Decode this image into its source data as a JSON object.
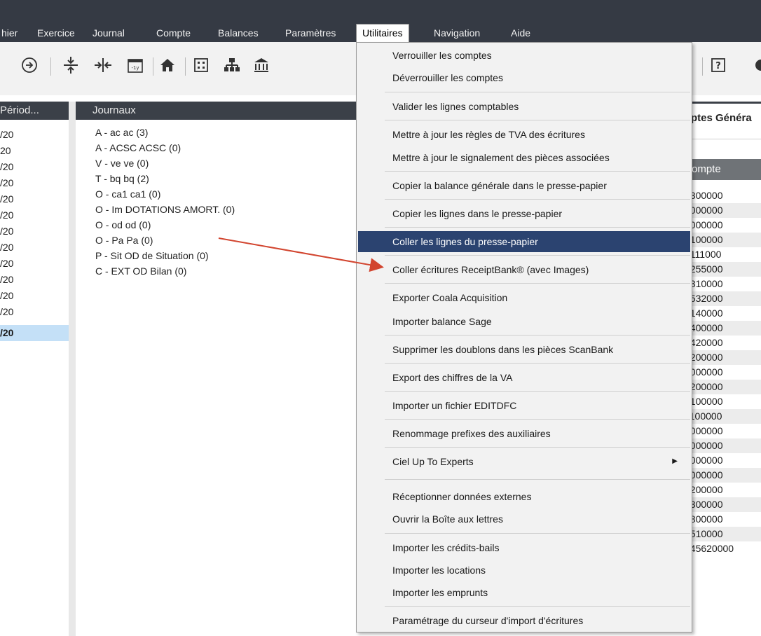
{
  "menu": {
    "items": [
      "hier",
      "Exercice",
      "Journal",
      "Compte",
      "Balances",
      "Paramètres",
      "Utilitaires",
      "Navigation",
      "Aide"
    ]
  },
  "toolbar": {
    "icons": [
      "arrow-right-circle-icon",
      "expand-vertical-icon",
      "collapse-horizontal-icon",
      "calendar-minus-1y-icon",
      "home-icon",
      "building-icon",
      "org-chart-icon",
      "bank-icon",
      "help-icon"
    ]
  },
  "periods": {
    "header": "Périod...",
    "rows": [
      "/20",
      "20",
      "/20",
      "/20",
      "/20",
      "/20",
      "/20",
      "/20",
      "/20",
      "/20",
      "/20",
      "/20",
      "/20"
    ]
  },
  "journals": {
    "header": "Journaux",
    "rows": [
      "A - ac ac (3)",
      "A - ACSC ACSC (0)",
      "V - ve ve (0)",
      "T - bq bq (2)",
      "O - ca1 ca1 (0)",
      "O - Im DOTATIONS AMORT. (0)",
      "O - od od (0)",
      "O - Pa Pa (0)",
      "P - Sit OD de Situation (0)",
      "C - EXT OD Bilan (0)"
    ]
  },
  "utilitaires_menu": {
    "items": [
      "Verrouiller les comptes",
      "Déverrouiller les comptes",
      "Valider les lignes comptables",
      "Mettre à jour les règles de TVA des écritures",
      "Mettre à jour le signalement des pièces associées",
      "Copier la balance générale dans le presse-papier",
      "Copier les lignes dans le presse-papier",
      "Coller les lignes du presse-papier",
      "Coller écritures ReceiptBank® (avec Images)",
      "Exporter Coala Acquisition",
      "Importer balance Sage",
      "Supprimer les doublons dans les pièces ScanBank",
      "Export des chiffres de la VA",
      "Importer un fichier EDITDFC",
      "Renommage prefixes des auxiliaires",
      "Ciel Up To Experts",
      "Réceptionner données externes",
      "Ouvrir la Boîte aux lettres",
      "Importer les crédits-bails",
      "Importer les locations",
      "Importer les emprunts",
      "Paramétrage du curseur d'import d'écritures"
    ],
    "highlighted": "Coller les lignes du presse-papier",
    "submenu_item": "Ciel Up To Experts"
  },
  "accounts": {
    "title": "ptes Généra",
    "column_header": "ompte",
    "rows": [
      "1300000",
      "0000000",
      "9000000",
      "4100000",
      "4111000",
      "4255000",
      "4310000",
      "4532000",
      "5140000",
      "5400000",
      "5420000",
      "3200000",
      "0000000",
      "1200000",
      "4100000",
      "1100000",
      "1000000",
      "5000000",
      "1000000",
      "7000000",
      "7200000",
      "7300000",
      "7800000",
      "5510000",
      "445620000"
    ]
  },
  "colors": {
    "menubar": "#353a44",
    "highlight": "#2b4370",
    "selection": "#c4e0f7",
    "annotation_arrow": "#d2452f"
  }
}
